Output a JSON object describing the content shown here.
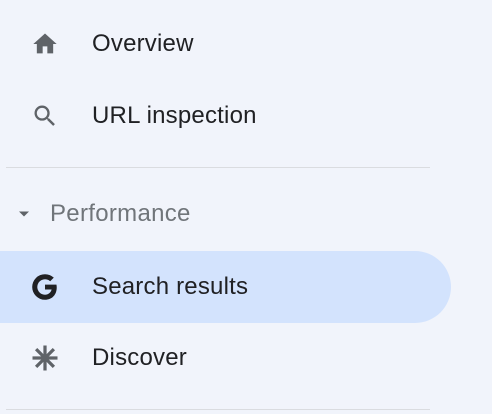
{
  "sidebar": {
    "items": [
      {
        "label": "Overview",
        "icon": "home-icon"
      },
      {
        "label": "URL inspection",
        "icon": "search-icon"
      }
    ],
    "performance_section": {
      "label": "Performance",
      "expanded": true,
      "icon": "caret-down-icon",
      "items": [
        {
          "label": "Search results",
          "icon": "google-g-icon",
          "selected": true
        },
        {
          "label": "Discover",
          "icon": "discover-asterisk-icon"
        }
      ]
    }
  },
  "colors": {
    "background": "#f1f4fb",
    "selected_item_background": "#d3e3fd",
    "text": "#202124",
    "section_label": "#70757a",
    "icon": "#5f6368",
    "divider": "#dadce0"
  }
}
